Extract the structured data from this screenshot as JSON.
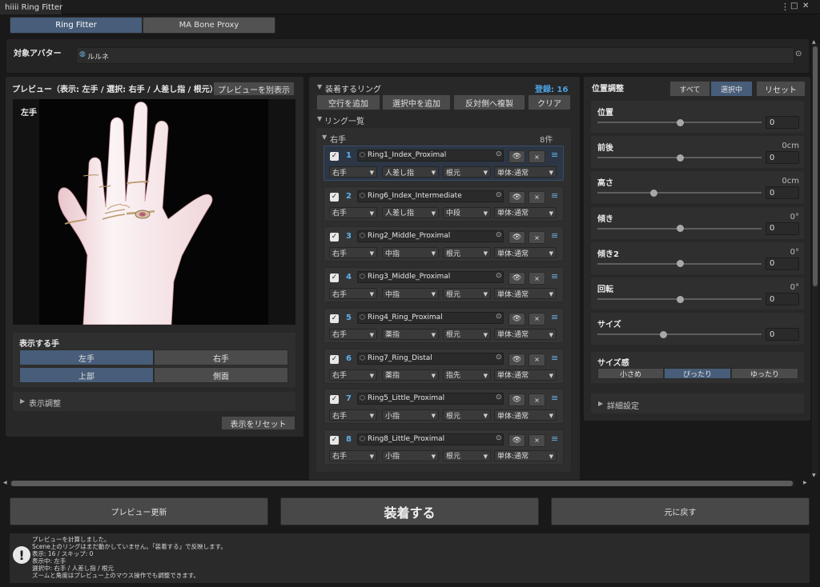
{
  "window": {
    "title": "hiiii Ring Fitter",
    "menu_icon": "kebab-menu-icon",
    "max_icon": "maximize-icon",
    "close_icon": "close-icon"
  },
  "tabs": [
    {
      "label": "Ring Fitter",
      "active": true
    },
    {
      "label": "MA Bone Proxy",
      "active": false
    }
  ],
  "avatar": {
    "label": "対象アバター",
    "value": "ルルネ"
  },
  "preview": {
    "title": "プレビュー（表示: 左手 / 選択: 右手 / 人差し指 / 根元）",
    "popout_button": "プレビューを別表示",
    "hand_label": "左手",
    "show_hand_title": "表示する手",
    "left": "左手",
    "right": "右手",
    "top": "上部",
    "side": "側面",
    "adjust": "表示調整",
    "reset": "表示をリセット"
  },
  "rings_panel": {
    "title": "装着するリング",
    "count_label": "登録: 16",
    "add_empty": "空行を追加",
    "add_selected": "選択中を追加",
    "mirror": "反対側へ複製",
    "clear": "クリア",
    "list_title": "リング一覧",
    "group": "右手",
    "group_count": "8件"
  },
  "rings": [
    {
      "idx": "1",
      "name": "Ring1_Index_Proximal",
      "hand": "右手",
      "finger": "人差し指",
      "seg": "根元",
      "mode": "単体:通常"
    },
    {
      "idx": "2",
      "name": "Ring6_Index_Intermediate",
      "hand": "右手",
      "finger": "人差し指",
      "seg": "中段",
      "mode": "単体:通常"
    },
    {
      "idx": "3",
      "name": "Ring2_Middle_Proximal",
      "hand": "右手",
      "finger": "中指",
      "seg": "根元",
      "mode": "単体:通常"
    },
    {
      "idx": "4",
      "name": "Ring3_Middle_Proximal",
      "hand": "右手",
      "finger": "中指",
      "seg": "根元",
      "mode": "単体:通常"
    },
    {
      "idx": "5",
      "name": "Ring4_Ring_Proximal",
      "hand": "右手",
      "finger": "薬指",
      "seg": "根元",
      "mode": "単体:通常"
    },
    {
      "idx": "6",
      "name": "Ring7_Ring_Distal",
      "hand": "右手",
      "finger": "薬指",
      "seg": "指先",
      "mode": "単体:通常"
    },
    {
      "idx": "7",
      "name": "Ring5_Little_Proximal",
      "hand": "右手",
      "finger": "小指",
      "seg": "根元",
      "mode": "単体:通常"
    },
    {
      "idx": "8",
      "name": "Ring8_Little_Proximal",
      "hand": "右手",
      "finger": "小指",
      "seg": "根元",
      "mode": "単体:通常"
    }
  ],
  "position": {
    "title": "位置調整",
    "all": "すべて",
    "selected": "選択中",
    "reset": "リセット",
    "params": [
      {
        "label": "位置",
        "unit": "",
        "value": "0",
        "slider": 0.5
      },
      {
        "label": "前後",
        "unit": "0cm",
        "value": "0",
        "slider": 0.5
      },
      {
        "label": "高さ",
        "unit": "0cm",
        "value": "0",
        "slider": 0.34
      },
      {
        "label": "傾き",
        "unit": "0°",
        "value": "0",
        "slider": 0.5
      },
      {
        "label": "傾き2",
        "unit": "0°",
        "value": "0",
        "slider": 0.5
      },
      {
        "label": "回転",
        "unit": "0°",
        "value": "0",
        "slider": 0.5
      },
      {
        "label": "サイズ",
        "unit": "",
        "value": "0",
        "slider": 0.4
      }
    ],
    "fit_title": "サイズ感",
    "fit_small": "小さめ",
    "fit_exact": "ぴったり",
    "fit_loose": "ゆったり",
    "advanced": "詳細設定"
  },
  "actions": {
    "update": "プレビュー更新",
    "apply": "装着する",
    "revert": "元に戻す"
  },
  "log": [
    "プレビューを計算しました。",
    "Scene上のリングはまだ動かしていません。「装着する」で反映します。",
    "表示: 16 / スキップ: 0",
    "表示中: 左手",
    "選択中: 右手 / 人差し指 / 根元",
    "ズームと角度はプレビュー上のマウス操作でも調整できます。"
  ],
  "colors": {
    "accent": "#475d79",
    "count": "#4ba3e3",
    "index": "#5fb0ec",
    "window": "#191919"
  }
}
